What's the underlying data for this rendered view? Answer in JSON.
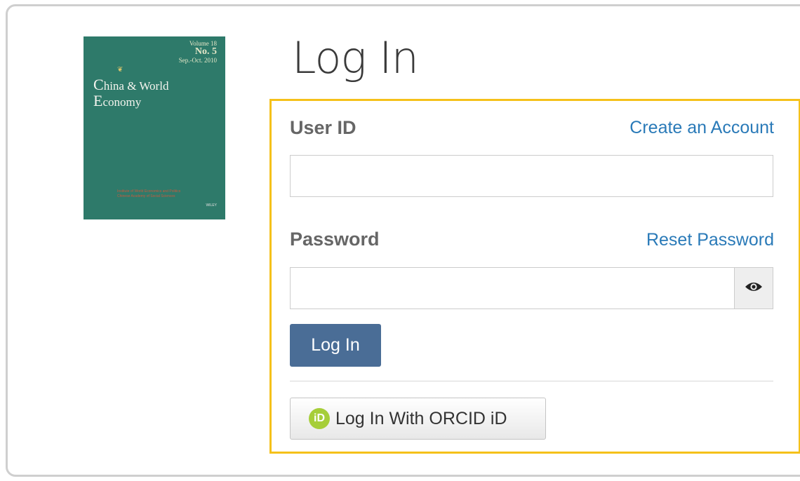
{
  "cover": {
    "volume": "Volume 18",
    "number": "No. 5",
    "date": "Sep.-Oct. 2010",
    "title_line1_initial": "C",
    "title_line1_rest": "hina & World",
    "title_line2_initial": "E",
    "title_line2_rest": "conomy",
    "publisher_line1": "Institute of World Economics and Politics",
    "publisher_line2": "Chinese Academy of Social Sciences",
    "publisher_mark": "WILEY"
  },
  "page": {
    "title": "Log In"
  },
  "form": {
    "user_id_label": "User ID",
    "create_account_link": "Create an Account",
    "user_id_value": "",
    "password_label": "Password",
    "reset_password_link": "Reset Password",
    "password_value": "",
    "show_password_icon": "eye-icon",
    "login_button_label": "Log In",
    "orcid_icon_text": "iD",
    "orcid_button_label": "Log In With ORCID iD"
  },
  "colors": {
    "highlight_border": "#f5c11a",
    "link": "#2a7ab8",
    "primary_button": "#4a6d96",
    "orcid": "#a6ce39",
    "cover": "#2e7a6a"
  }
}
